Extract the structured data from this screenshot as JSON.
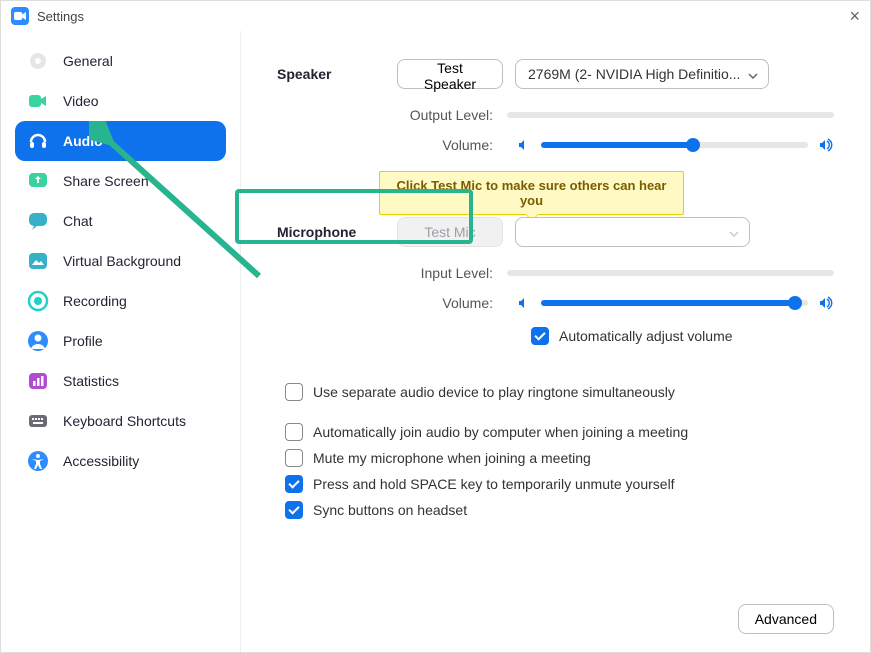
{
  "window": {
    "title": "Settings"
  },
  "sidebar": {
    "items": [
      {
        "name": "general",
        "label": "General",
        "active": false
      },
      {
        "name": "video",
        "label": "Video",
        "active": false
      },
      {
        "name": "audio",
        "label": "Audio",
        "active": true
      },
      {
        "name": "share-screen",
        "label": "Share Screen",
        "active": false
      },
      {
        "name": "chat",
        "label": "Chat",
        "active": false
      },
      {
        "name": "virtual-background",
        "label": "Virtual Background",
        "active": false
      },
      {
        "name": "recording",
        "label": "Recording",
        "active": false
      },
      {
        "name": "profile",
        "label": "Profile",
        "active": false
      },
      {
        "name": "statistics",
        "label": "Statistics",
        "active": false
      },
      {
        "name": "keyboard-shortcuts",
        "label": "Keyboard Shortcuts",
        "active": false
      },
      {
        "name": "accessibility",
        "label": "Accessibility",
        "active": false
      }
    ]
  },
  "audio": {
    "speaker_section": "Speaker",
    "test_speaker_btn": "Test Speaker",
    "speaker_device": "2769M (2- NVIDIA High Definitio...",
    "output_level_label": "Output Level:",
    "speaker_volume_label": "Volume:",
    "speaker_volume_percent": 57,
    "tooltip": "Click Test Mic to make sure others can hear you",
    "mic_section": "Microphone",
    "test_mic_btn": "Test Mic",
    "mic_device": "",
    "input_level_label": "Input Level:",
    "mic_volume_label": "Volume:",
    "mic_volume_percent": 95,
    "auto_adjust_label": "Automatically adjust volume",
    "auto_adjust_checked": true,
    "options": [
      {
        "label": "Use separate audio device to play ringtone simultaneously",
        "checked": false
      },
      {
        "label": "Automatically join audio by computer when joining a meeting",
        "checked": false
      },
      {
        "label": "Mute my microphone when joining a meeting",
        "checked": false
      },
      {
        "label": "Press and hold SPACE key to temporarily unmute yourself",
        "checked": true
      },
      {
        "label": "Sync buttons on headset",
        "checked": true
      }
    ],
    "advanced_btn": "Advanced"
  },
  "colors": {
    "accent": "#0E72ED",
    "highlight": "#27B48F",
    "tooltip_bg": "#FFF9C4"
  }
}
